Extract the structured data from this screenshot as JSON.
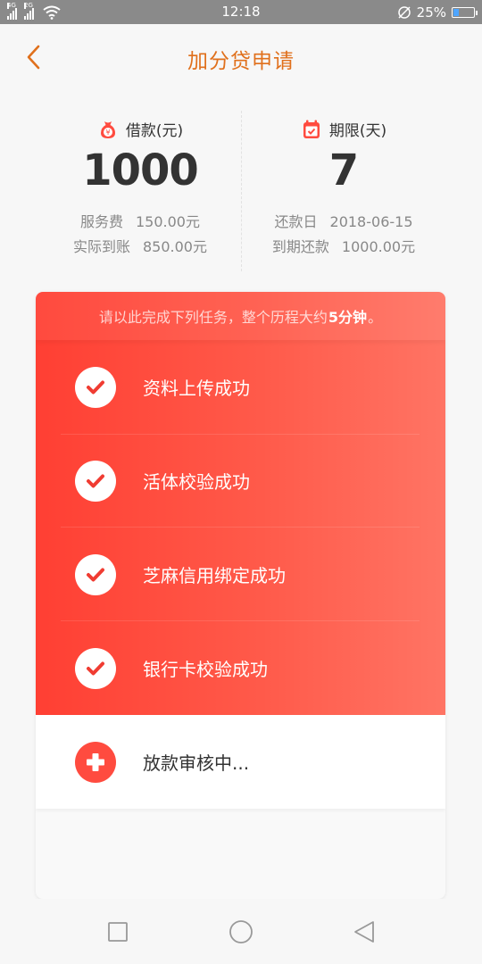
{
  "status_bar": {
    "network_1": "4G",
    "network_2": "2G",
    "time": "12:18",
    "battery_percent": "25%",
    "battery_level": 0.25
  },
  "header": {
    "title": "加分贷申请",
    "back_icon": "chevron-left-icon",
    "accent_color": "#e0701c"
  },
  "summary": {
    "loan": {
      "label": "借款(元)",
      "icon": "money-bag-icon",
      "value": "1000",
      "fee_label": "服务费",
      "fee_value": "150.00元",
      "received_label": "实际到账",
      "received_value": "850.00元"
    },
    "term": {
      "label": "期限(天)",
      "icon": "calendar-check-icon",
      "value": "7",
      "due_date_label": "还款日",
      "due_date_value": "2018-06-15",
      "due_amount_label": "到期还款",
      "due_amount_value": "1000.00元"
    }
  },
  "tasks": {
    "tip_prefix": "请以此完成下列任务，整个历程大约",
    "tip_strong": "5分钟",
    "tip_suffix": "。",
    "items": [
      {
        "label": "资料上传成功",
        "status": "done",
        "icon": "check-icon"
      },
      {
        "label": "活体校验成功",
        "status": "done",
        "icon": "check-icon"
      },
      {
        "label": "芝麻信用绑定成功",
        "status": "done",
        "icon": "check-icon"
      },
      {
        "label": "银行卡校验成功",
        "status": "done",
        "icon": "check-icon"
      }
    ],
    "pending": {
      "label": "放款审核中...",
      "status": "pending",
      "icon": "plus-icon"
    },
    "colors": {
      "card_red": "#ff4b3f",
      "check": "#f03c32"
    }
  },
  "nav": {
    "recent_icon": "square-icon",
    "home_icon": "circle-icon",
    "back_icon": "triangle-back-icon"
  }
}
